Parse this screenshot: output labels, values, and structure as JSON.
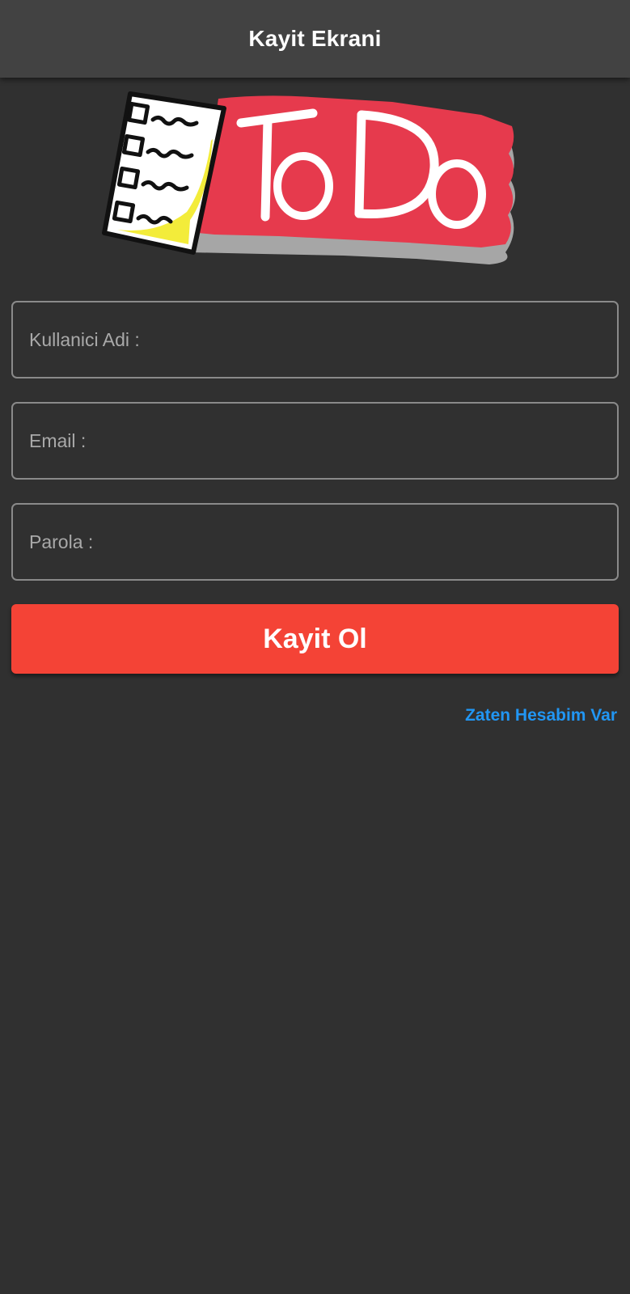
{
  "app_bar": {
    "title": "Kayit Ekrani"
  },
  "logo": {
    "name": "todo-logo",
    "text": "ToDo",
    "banner_color": "#e63a4d",
    "note_color": "#ffffff",
    "highlight_color": "#f3ec3a"
  },
  "form": {
    "username": {
      "placeholder": "Kullanici Adi :",
      "value": ""
    },
    "email": {
      "placeholder": "Email :",
      "value": ""
    },
    "password": {
      "placeholder": "Parola :",
      "value": ""
    }
  },
  "register_button": {
    "label": "Kayit Ol",
    "color": "#f44336"
  },
  "login_link": {
    "label": "Zaten Hesabim Var",
    "color": "#2196f3"
  },
  "theme": {
    "background": "#303030",
    "app_bar": "#424242"
  }
}
